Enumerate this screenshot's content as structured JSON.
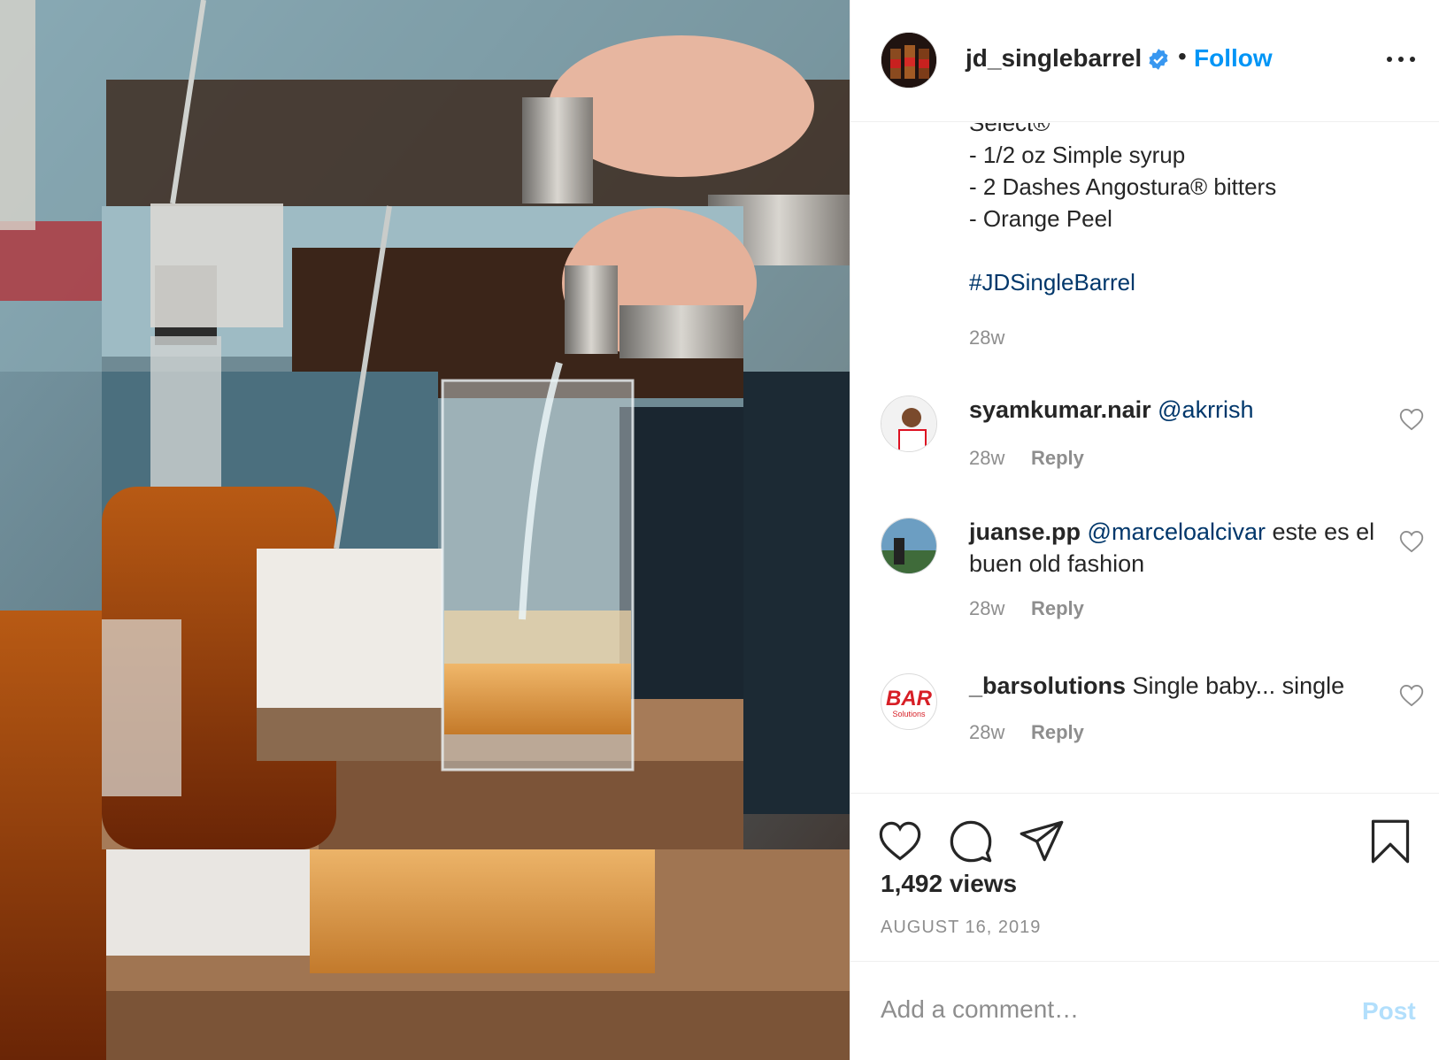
{
  "post": {
    "username": "jd_singlebarrel",
    "separator": "•",
    "follow_label": "Follow",
    "caption_lines": [
      "Select®",
      "- 1/2 oz Simple syrup",
      "- 2 Dashes Angostura® bitters",
      "- Orange Peel"
    ],
    "hashtag": "#JDSingleBarrel",
    "caption_time": "28w"
  },
  "comments": [
    {
      "username": "syamkumar.nair",
      "mention": "@akrrish",
      "text": "",
      "time": "28w",
      "reply_label": "Reply"
    },
    {
      "username": "juanse.pp",
      "mention": "@marceloalcivar",
      "text": "este es el buen old fashion",
      "time": "28w",
      "reply_label": "Reply"
    },
    {
      "username": "_barsolutions",
      "mention": "",
      "text": "Single baby... single",
      "time": "28w",
      "reply_label": "Reply",
      "avatar_text": "BAR",
      "avatar_subtext": "Solutions"
    }
  ],
  "stats": {
    "views": "1,492 views",
    "date": "AUGUST 16, 2019"
  },
  "composer": {
    "placeholder": "Add a comment…",
    "post_label": "Post"
  },
  "colors": {
    "accent": "#0095f6",
    "link": "#00376b",
    "muted": "#8e8e8e",
    "post_disabled": "#b2dffc"
  },
  "icons": {
    "verified": "verified-badge-icon",
    "more": "more-options-icon",
    "like": "heart-icon",
    "comment": "comment-bubble-icon",
    "share": "paper-plane-icon",
    "save": "bookmark-icon"
  }
}
